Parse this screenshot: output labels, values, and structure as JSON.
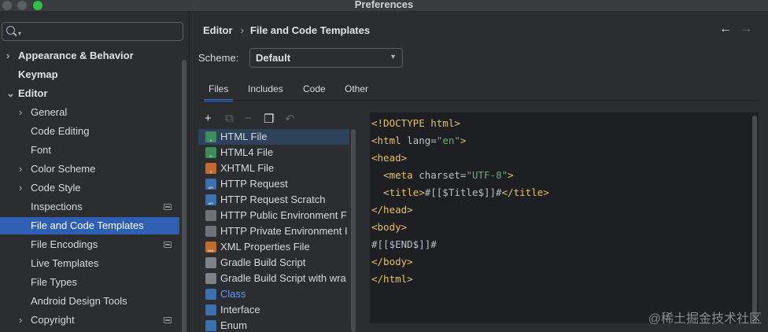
{
  "window": {
    "title": "Preferences"
  },
  "search": {
    "placeholder": ""
  },
  "sidebar": {
    "items": [
      {
        "label": "Appearance & Behavior",
        "chevron": "›",
        "bold": true
      },
      {
        "label": "Keymap",
        "chevron": "",
        "bold": true
      },
      {
        "label": "Editor",
        "chevron": "⌄",
        "bold": true
      },
      {
        "label": "General",
        "chevron": "›"
      },
      {
        "label": "Code Editing",
        "chevron": ""
      },
      {
        "label": "Font",
        "chevron": ""
      },
      {
        "label": "Color Scheme",
        "chevron": "›"
      },
      {
        "label": "Code Style",
        "chevron": "›"
      },
      {
        "label": "Inspections",
        "chevron": "",
        "badge": true
      },
      {
        "label": "File and Code Templates",
        "chevron": "",
        "selected": true
      },
      {
        "label": "File Encodings",
        "chevron": "",
        "badge": true
      },
      {
        "label": "Live Templates",
        "chevron": ""
      },
      {
        "label": "File Types",
        "chevron": ""
      },
      {
        "label": "Android Design Tools",
        "chevron": ""
      },
      {
        "label": "Copyright",
        "chevron": "›",
        "badge": true
      }
    ]
  },
  "breadcrumb": {
    "parent": "Editor",
    "separator": "›",
    "current": "File and Code Templates"
  },
  "nav": {
    "back": "←",
    "forward": "→"
  },
  "scheme": {
    "label": "Scheme:",
    "value": "Default",
    "arrow": "▼"
  },
  "tabs": [
    "Files",
    "Includes",
    "Code",
    "Other"
  ],
  "toolbar": {
    "add": "+",
    "copy": "⧉",
    "remove": "−",
    "duplicate": "❐",
    "reset": "↶"
  },
  "templates": [
    {
      "label": "HTML File",
      "icon": "html-file-icon",
      "color": "#3e8b5b",
      "tag": "5",
      "selected": true
    },
    {
      "label": "HTML4 File",
      "icon": "html4-file-icon",
      "color": "#3e8b5b",
      "tag": "H"
    },
    {
      "label": "XHTML File",
      "icon": "xhtml-file-icon",
      "color": "#c16b2c",
      "tag": "X"
    },
    {
      "label": "HTTP Request",
      "icon": "http-request-icon",
      "color": "#3b6fb0",
      "tag": "API"
    },
    {
      "label": "HTTP Request Scratch",
      "icon": "http-request-scratch-icon",
      "color": "#3b6fb0",
      "tag": "API"
    },
    {
      "label": "HTTP Public Environment F",
      "icon": "gear-file-icon",
      "color": "#6f7378",
      "tag": ""
    },
    {
      "label": "HTTP Private Environment I",
      "icon": "gear-file-icon",
      "color": "#6f7378",
      "tag": ""
    },
    {
      "label": "XML Properties File",
      "icon": "xml-file-icon",
      "color": "#c16b2c",
      "tag": "XML"
    },
    {
      "label": "Gradle Build Script",
      "icon": "gradle-icon",
      "color": "#7e8186",
      "tag": ""
    },
    {
      "label": "Gradle Build Script with wra",
      "icon": "gradle-icon",
      "color": "#7e8186",
      "tag": ""
    },
    {
      "label": "Class",
      "icon": "class-file-icon",
      "color": "#3b6fb0",
      "tag": "",
      "link": true
    },
    {
      "label": "Interface",
      "icon": "interface-file-icon",
      "color": "#3b6fb0",
      "tag": ""
    },
    {
      "label": "Enum",
      "icon": "enum-file-icon",
      "color": "#3b6fb0",
      "tag": ""
    }
  ],
  "code": [
    [
      {
        "t": "<!DOCTYPE html>",
        "c": "tagc"
      }
    ],
    [
      {
        "t": "<html ",
        "c": "tagc"
      },
      {
        "t": "lang=",
        "c": "txt"
      },
      {
        "t": "\"en\"",
        "c": "str"
      },
      {
        "t": ">",
        "c": "tagc"
      }
    ],
    [
      {
        "t": "<head>",
        "c": "tagc"
      }
    ],
    [
      {
        "t": "  <meta ",
        "c": "tagc"
      },
      {
        "t": "charset=",
        "c": "txt"
      },
      {
        "t": "\"UTF-8\"",
        "c": "str"
      },
      {
        "t": ">",
        "c": "tagc"
      }
    ],
    [
      {
        "t": "  <title>",
        "c": "tagc"
      },
      {
        "t": "#[[$Title$]]#",
        "c": "txt"
      },
      {
        "t": "</title>",
        "c": "tagc"
      }
    ],
    [
      {
        "t": "</head>",
        "c": "tagc"
      }
    ],
    [
      {
        "t": "<body>",
        "c": "tagc"
      }
    ],
    [
      {
        "t": "#[[$END$]]#",
        "c": "txt"
      }
    ],
    [
      {
        "t": "</body>",
        "c": "tagc"
      }
    ],
    [
      {
        "t": "</html>",
        "c": "tagc"
      }
    ]
  ],
  "watermark": "@稀土掘金技术社区"
}
